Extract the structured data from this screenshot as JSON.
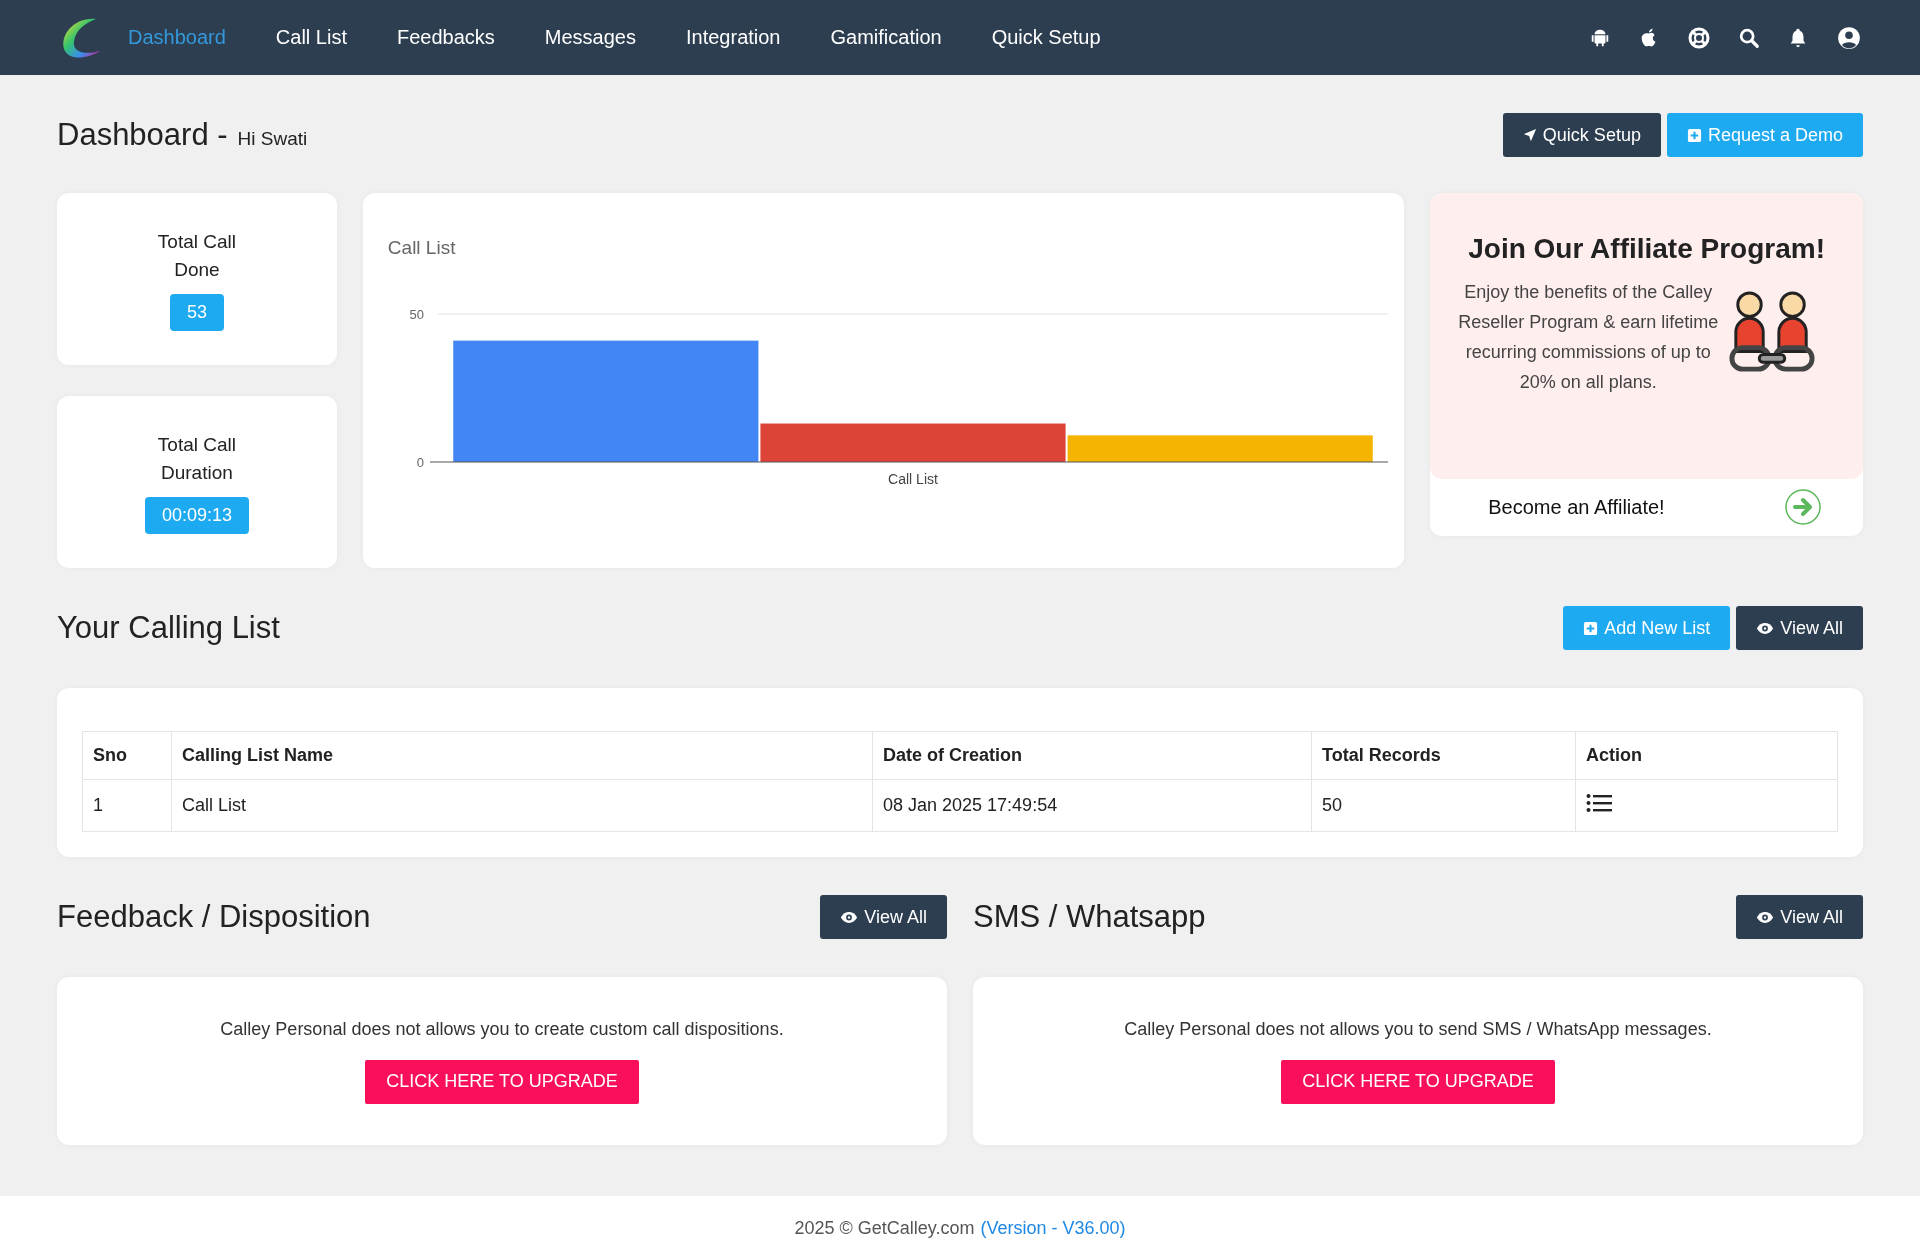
{
  "nav": {
    "items": [
      {
        "label": "Dashboard",
        "selected": true
      },
      {
        "label": "Call List",
        "selected": false
      },
      {
        "label": "Feedbacks",
        "selected": false
      },
      {
        "label": "Messages",
        "selected": false
      },
      {
        "label": "Integration",
        "selected": false
      },
      {
        "label": "Gamification",
        "selected": false
      },
      {
        "label": "Quick Setup",
        "selected": false
      }
    ]
  },
  "header": {
    "title": "Dashboard -",
    "greeting": "Hi Swati",
    "buttons": [
      {
        "label": "Quick Setup",
        "kind": "dark"
      },
      {
        "label": "Request a Demo",
        "kind": "blue"
      }
    ]
  },
  "stats": [
    {
      "label": "Total Call Done",
      "value": "53"
    },
    {
      "label": "Total Call Duration",
      "value": "00:09:13"
    }
  ],
  "chart_card": {
    "chart_data": {
      "type": "bar",
      "title": "Call List",
      "categories": [
        "Call List"
      ],
      "series": [
        {
          "color": "#4285f4",
          "values": [
            41
          ]
        },
        {
          "color": "#db4437",
          "values": [
            13
          ]
        },
        {
          "color": "#f4b400",
          "values": [
            9
          ]
        }
      ],
      "ylim": [
        0,
        50
      ],
      "yticks": [
        0,
        50
      ]
    }
  },
  "affiliate": {
    "title": "Join Our Affiliate Program!",
    "text": "Enjoy the benefits of the Calley Reseller Program & earn lifetime recurring commissions of up to 20% on all plans.",
    "link": "Become an Affiliate!"
  },
  "calling_list": {
    "title": "Your Calling List",
    "buttons": [
      {
        "label": "Add New List",
        "kind": "blue"
      },
      {
        "label": "View All",
        "kind": "dark"
      }
    ],
    "columns": [
      "Sno",
      "Calling List Name",
      "Date of Creation",
      "Total Records",
      "Action"
    ],
    "rows": [
      {
        "sno": "1",
        "name": "Call List",
        "date": "08 Jan 2025 17:49:54",
        "records": "50"
      }
    ]
  },
  "panels": [
    {
      "title": "Feedback / Disposition",
      "button": "View All",
      "message": "Calley Personal does not allows you to create custom call dispositions.",
      "upgrade": "CLICK HERE TO UPGRADE"
    },
    {
      "title": "SMS / Whatsapp",
      "button": "View All",
      "message": "Calley Personal does not allows you to send SMS / WhatsApp messages.",
      "upgrade": "CLICK HERE TO UPGRADE"
    }
  ],
  "footer": {
    "text": "2025 © GetCalley.com",
    "version": "(Version - V36.00)"
  }
}
